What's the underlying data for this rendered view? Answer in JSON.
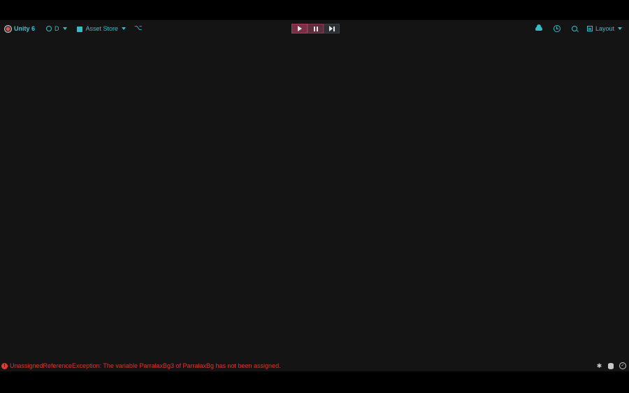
{
  "toolbar": {
    "app_title": "Unity 6",
    "account_label": "D",
    "asset_store_label": "Asset Store",
    "layout_label": "Layout"
  },
  "playbar": {
    "buttons": [
      "play",
      "pause",
      "step"
    ]
  },
  "status": {
    "error_icon_glyph": "!",
    "error_message": "UnassignedReferenceException: The variable ParralaxBg3 of ParralaxBg has not been assigned."
  },
  "colors": {
    "accent": "#35bcc7",
    "error": "#d33a30",
    "background": "#141414",
    "play_active": "#7a2f47"
  },
  "icons": [
    "unity-logo-icon",
    "account-icon",
    "asset-store-icon",
    "version-control-icon",
    "cloud-icon",
    "history-icon",
    "search-icon",
    "layout-icon",
    "error-icon",
    "bug-icon",
    "database-icon",
    "check-icon"
  ]
}
